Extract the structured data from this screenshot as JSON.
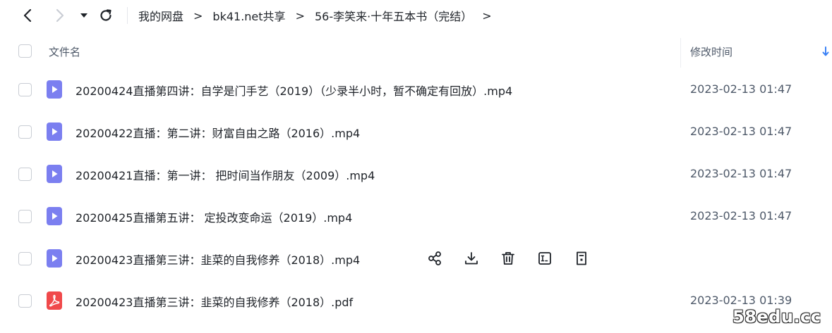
{
  "breadcrumb": [
    {
      "label": "我的网盘"
    },
    {
      "label": "bk41.net共享"
    },
    {
      "label": "56-李笑来·十年五本书（完结）"
    }
  ],
  "breadcrumb_separator": ">",
  "table": {
    "col_name": "文件名",
    "col_time": "修改时间"
  },
  "files": [
    {
      "name": "20200424直播第四讲：自学是门手艺（2019）（少录半小时，暂不确定有回放）.mp4",
      "time": "2023-02-13 01:47",
      "type": "video"
    },
    {
      "name": "20200422直播：第二讲：财富自由之路（2016）.mp4",
      "time": "2023-02-13 01:47",
      "type": "video"
    },
    {
      "name": "20200421直播：第一讲： 把时间当作朋友（2009）.mp4",
      "time": "2023-02-13 01:47",
      "type": "video"
    },
    {
      "name": "20200425直播第五讲： 定投改变命运（2019）.mp4",
      "time": "2023-02-13 01:47",
      "type": "video"
    },
    {
      "name": "20200423直播第三讲：韭菜的自我修养（2018）.mp4",
      "time": "",
      "type": "video",
      "hovered": true
    },
    {
      "name": "20200423直播第三讲：韭菜的自我修养（2018）.pdf",
      "time": "2023-02-13 01:39",
      "type": "pdf"
    }
  ],
  "icons": {
    "back": "chevron-left-icon",
    "forward": "chevron-right-icon",
    "history": "caret-down-icon",
    "refresh": "refresh-icon",
    "sort": "arrow-down-icon",
    "video": "video-file-icon",
    "pdf": "pdf-file-icon",
    "row_actions": [
      "share-icon",
      "download-icon",
      "delete-icon",
      "rename-icon",
      "details-icon"
    ]
  },
  "colors": {
    "video_icon": "#7b7ff0",
    "pdf_icon": "#f0494b",
    "sort_arrow": "#3b82f6"
  },
  "watermark": "58edu.cc"
}
